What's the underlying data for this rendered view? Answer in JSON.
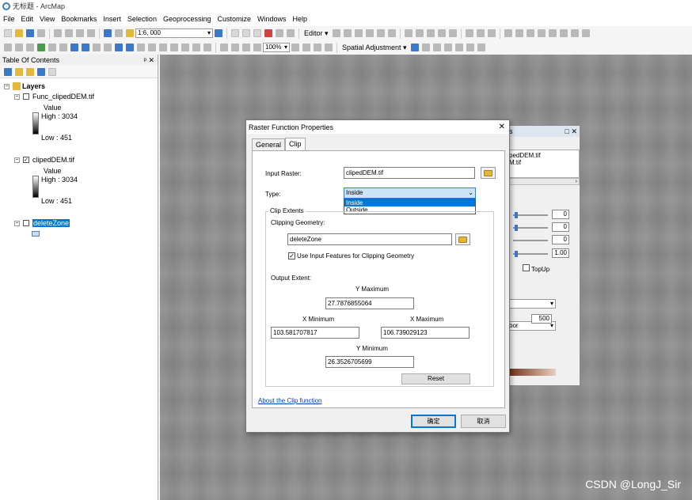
{
  "window": {
    "title": "无标题 - ArcMap"
  },
  "menu": [
    "File",
    "Edit",
    "View",
    "Bookmarks",
    "Insert",
    "Selection",
    "Geoprocessing",
    "Customize",
    "Windows",
    "Help"
  ],
  "toolbar": {
    "scale": "1:6, 000",
    "editor_label": "Editor ▾",
    "zoom": "100%",
    "spatial_adjustment": "Spatial Adjustment ▾"
  },
  "toc": {
    "title": "Table Of Contents",
    "pin": "ᵖ",
    "close": "✕",
    "root": "Layers",
    "layers": [
      {
        "name": "Func_clipedDEM.tif",
        "checked": "",
        "value_label": "Value",
        "high": "High : 3034",
        "low": "Low : 451"
      },
      {
        "name": "clipedDEM.tif",
        "checked": "✓",
        "value_label": "Value",
        "high": "High : 3034",
        "low": "Low : 451"
      },
      {
        "name": "deleteZone",
        "checked": ""
      }
    ]
  },
  "side_panel": {
    "title_fragment": "is",
    "items": [
      "pedDEM.tif",
      "M.tif"
    ],
    "values": [
      "0",
      "0",
      "0",
      "1.00"
    ],
    "topup": "TopUp",
    "combo2": "bor",
    "size": "500"
  },
  "dialog": {
    "title": "Raster Function Properties",
    "close": "✕",
    "tabs": [
      "General",
      "Clip"
    ],
    "input_raster_label": "Input Raster:",
    "input_raster": "clipedDEM.tif",
    "type_label": "Type:",
    "type_value": "Inside",
    "type_options": [
      "Inside",
      "Outside"
    ],
    "clip_extents_label": "Clip Extents",
    "clipping_geometry_label": "Clipping Geometry:",
    "clipping_geometry": "deleteZone",
    "use_input_features": "Use Input Features for Clipping Geometry",
    "use_input_checked": "✓",
    "output_extent_label": "Output Extent:",
    "y_max_label": "Y Maximum",
    "y_max": "27.7876855064",
    "x_min_label": "X Minimum",
    "x_min": "103.581707817",
    "x_max_label": "X Maximum",
    "x_max": "106.739029123",
    "y_min_label": "Y Minimum",
    "y_min": "26.3526705699",
    "reset": "Reset",
    "about_link": "About the Clip function",
    "ok": "确定",
    "cancel": "取消"
  },
  "watermark": "CSDN @LongJ_Sir"
}
